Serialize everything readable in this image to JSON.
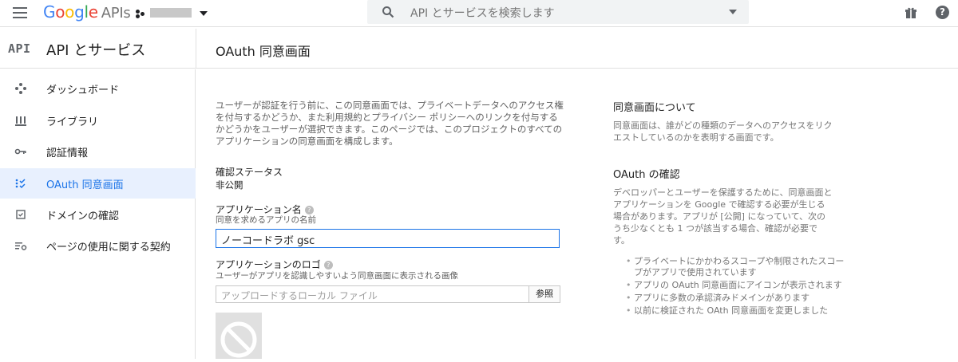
{
  "topbar": {
    "menu_icon": "hamburger-menu-icon",
    "brand_google": "Google",
    "brand_apis": "APIs",
    "search_placeholder": "API とサービスを検索します",
    "search_icon": "search-icon",
    "gift_icon": "gift-icon",
    "help_icon": "help-icon",
    "help_glyph": "?"
  },
  "header": {
    "api_badge": "API",
    "section_title": "API とサービス",
    "page_title": "OAuth 同意画面"
  },
  "sidebar": {
    "items": [
      {
        "label": "ダッシュボード",
        "icon": "dashboard-icon",
        "active": false
      },
      {
        "label": "ライブラリ",
        "icon": "library-icon",
        "active": false
      },
      {
        "label": "認証情報",
        "icon": "key-icon",
        "active": false
      },
      {
        "label": "OAuth 同意画面",
        "icon": "consent-screen-icon",
        "active": true
      },
      {
        "label": "ドメインの確認",
        "icon": "checkbox-icon",
        "active": false
      },
      {
        "label": "ページの使用に関する契約",
        "icon": "settings-list-icon",
        "active": false
      }
    ]
  },
  "main": {
    "description": "ユーザーが認証を行う前に、この同意画面では、プライベートデータへのアクセス権を付与するかどうか、また利用規約とプライバシー ポリシーへのリンクを付与するかどうかをユーザーが選択できます。このページでは、このプロジェクトのすべてのアプリケーションの同意画面を構成します。",
    "status_label": "確認ステータス",
    "status_value": "非公開",
    "app_name_label": "アプリケーション名",
    "app_name_hint": "同意を求めるアプリの名前",
    "app_name_value": "ノーコードラボ gsc",
    "app_logo_label": "アプリケーションのロゴ",
    "app_logo_hint": "ユーザーがアプリを認識しやすいよう同意画面に表示される画像",
    "file_placeholder": "アップロードするローカル ファイル",
    "browse_label": "参照",
    "help_glyph": "?"
  },
  "help_panel": {
    "consent_title": "同意画面について",
    "consent_text": "同意画面は、誰がどの種類のデータへのアクセスをリクエストしているのかを表明する画面です。",
    "verify_title": "OAuth の確認",
    "verify_text": "デベロッパーとユーザーを保護するために、同意画面とアプリケーションを Google で確認する必要が生じる場合があります。アプリが [公開] になっていて、次のうち少なくとも 1 つが該当する場合、確認が必要です。",
    "bullets": [
      "プライベートにかかわるスコープや制限されたスコープがアプリで使用されています",
      "アプリの OAuth 同意画面にアイコンが表示されます",
      "アプリに多数の承認済みドメインがあります",
      "以前に検証された OAth 同意画面を変更しました"
    ]
  },
  "colors": {
    "accent": "#1a73e8",
    "active_bg": "#e8f0fe"
  }
}
